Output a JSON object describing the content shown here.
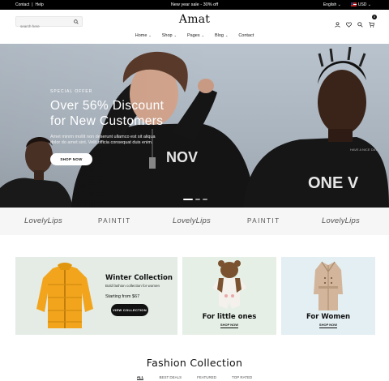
{
  "topbar": {
    "links": [
      "Contact",
      "Help"
    ],
    "announcement": "New year sale - 30% off",
    "language": "English",
    "currency": "USD"
  },
  "header": {
    "search_placeholder": "search here",
    "logo": "Amat",
    "cart_count": "0",
    "nav": [
      {
        "label": "Home"
      },
      {
        "label": "Shop"
      },
      {
        "label": "Pages"
      },
      {
        "label": "Blog"
      },
      {
        "label": "Contact"
      }
    ]
  },
  "hero": {
    "eyebrow": "SPECIAL OFFER",
    "title_line1": "Over 56% Discount",
    "title_line2": "for New Customers",
    "description": "Amet minim mollit non deserunt ullamco est sit aliqua dolor do amet sint. Velit officia consequat duis enim.",
    "button": "SHOP NOW",
    "slides": 3,
    "active_slide": 1
  },
  "brands": [
    "LovelyLips",
    "PAINTIT",
    "LovelyLips",
    "PAINTIT",
    "LovelyLips"
  ],
  "collections": {
    "winter": {
      "title": "Winter Collection",
      "subtitle": "Bold fashion collection for women",
      "price": "Starting from $67",
      "button": "VIEW COLLECTION"
    },
    "little": {
      "title": "For little ones",
      "link": "SHOP NOW"
    },
    "women": {
      "title": "For Women",
      "link": "SHOP NOW"
    }
  },
  "fashion": {
    "title": "Fashion Collection",
    "tabs": [
      "ALL",
      "BEST DEALS",
      "FEATURED",
      "TOP RATED"
    ]
  },
  "colors": {
    "topbar": "#000000",
    "card_green": "#e4ece5",
    "card_blue": "#e3eff3",
    "jacket": "#f2a51c"
  }
}
